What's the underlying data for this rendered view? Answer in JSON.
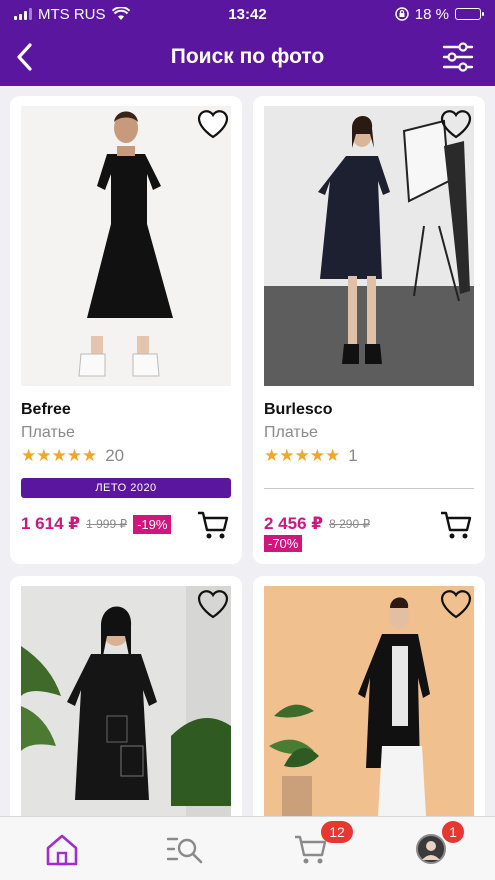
{
  "status_bar": {
    "carrier": "MTS RUS",
    "time": "13:42",
    "battery": "18 %"
  },
  "header": {
    "title": "Поиск по фото"
  },
  "products": [
    {
      "brand": "Befree",
      "category": "Платье",
      "stars": "★★★★★",
      "reviews": "20",
      "tag": "ЛЕТО 2020",
      "price": "1 614 ₽",
      "old_price": "1 999 ₽",
      "discount": "-19%"
    },
    {
      "brand": "Burlesco",
      "category": "Платье",
      "stars": "★★★★★",
      "reviews": "1",
      "price": "2 456 ₽",
      "old_price": "8 290 ₽",
      "discount": "-70%"
    }
  ],
  "tabbar": {
    "cart_badge": "12",
    "profile_badge": "1"
  },
  "colors": {
    "brand_purple": "#5b169f",
    "price_pink": "#d0167d",
    "star_orange": "#f5a623",
    "badge_red": "#e8372f"
  },
  "icons": {
    "back": "chevron-left-icon",
    "filter": "sliders-icon",
    "favorite": "heart-icon",
    "cart": "cart-icon",
    "home": "home-icon",
    "catalog": "search-list-icon",
    "profile": "avatar-icon"
  }
}
